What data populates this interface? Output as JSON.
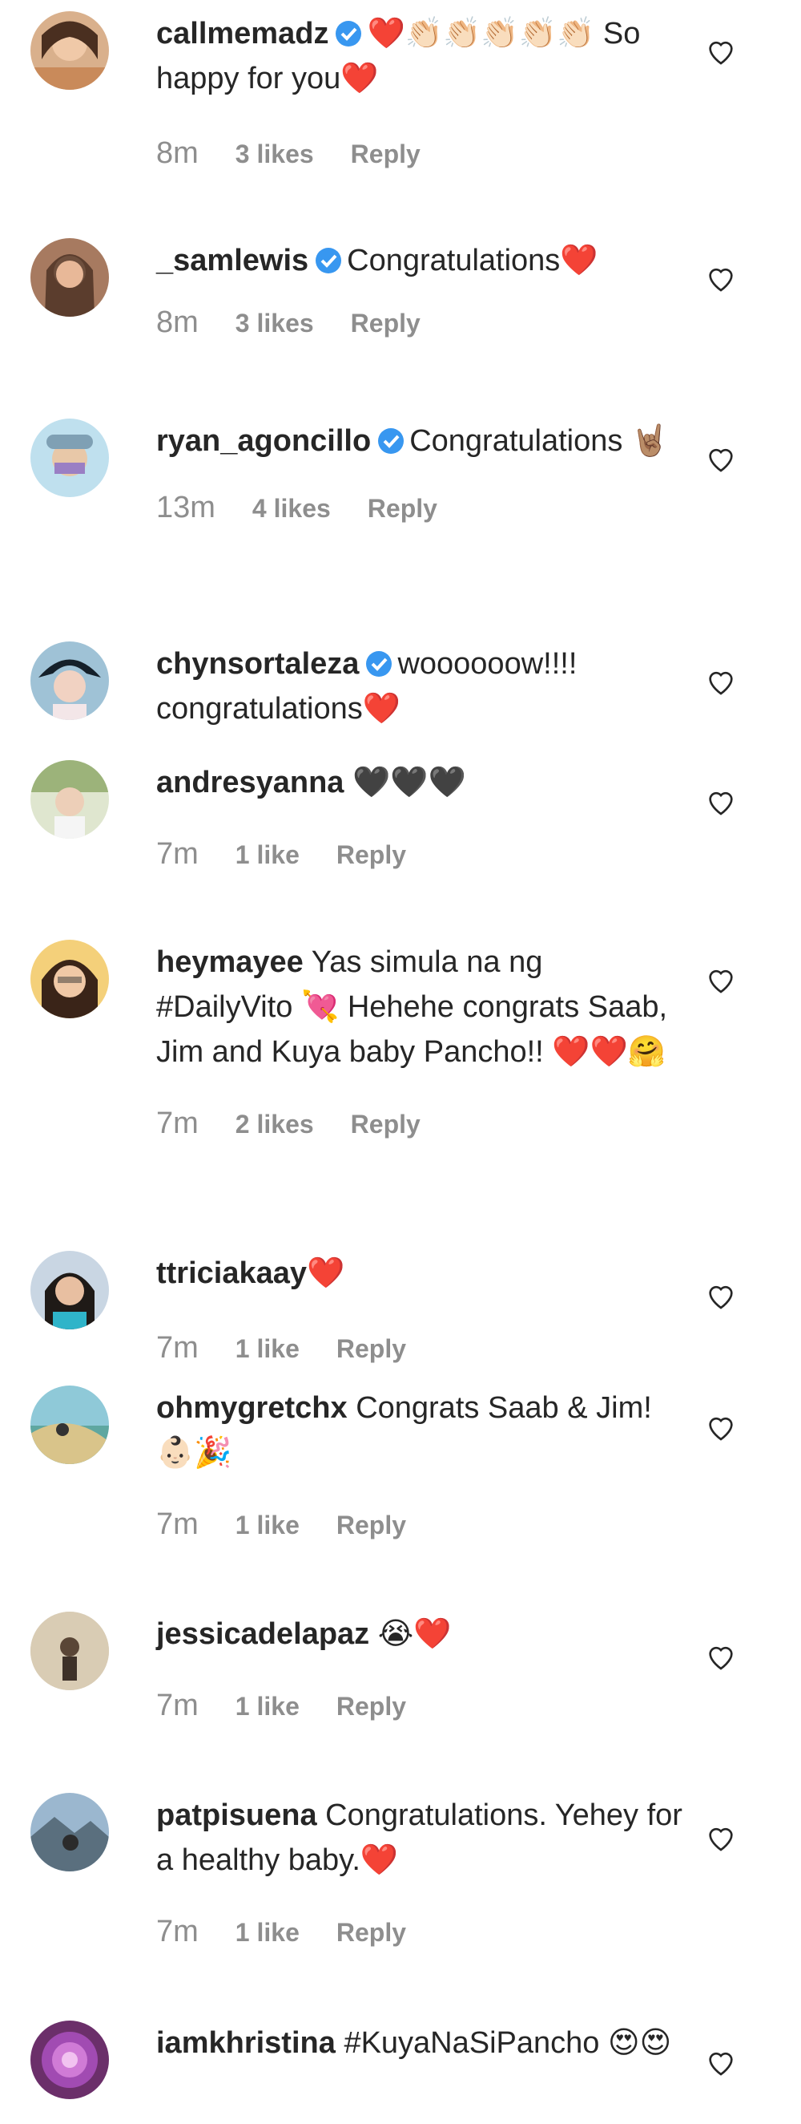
{
  "comments": [
    {
      "username": "callmemadz",
      "verified": true,
      "text": "❤️👏🏻👏🏻👏🏻👏🏻👏🏻 So happy for you❤️",
      "time": "8m",
      "likes": "3 likes",
      "reply": "Reply"
    },
    {
      "username": "_samlewis",
      "verified": true,
      "text": "Congratulations❤️",
      "time": "8m",
      "likes": "3 likes",
      "reply": "Reply"
    },
    {
      "username": "ryan_agoncillo",
      "verified": true,
      "text": "Congratulations 🤘🏽",
      "time": "13m",
      "likes": "4 likes",
      "reply": "Reply"
    },
    {
      "username": "chynsortaleza",
      "verified": true,
      "text": "woooooow!!!! congratulations❤️",
      "time": "",
      "likes": "",
      "reply": ""
    },
    {
      "username": "andresyanna",
      "verified": false,
      "text": "🖤🖤🖤",
      "time": "7m",
      "likes": "1 like",
      "reply": "Reply"
    },
    {
      "username": "heymayee",
      "verified": false,
      "text": "Yas simula na ng #DailyVito 💘 Hehehe congrats Saab, Jim and Kuya baby Pancho!! ❤️❤️🤗",
      "time": "7m",
      "likes": "2 likes",
      "reply": "Reply"
    },
    {
      "username": "ttriciakaay",
      "verified": false,
      "text": "❤️",
      "time": "7m",
      "likes": "1 like",
      "reply": "Reply"
    },
    {
      "username": "ohmygretchx",
      "verified": false,
      "text": "Congrats Saab & Jim! 👶🏻🎉",
      "time": "7m",
      "likes": "1 like",
      "reply": "Reply"
    },
    {
      "username": "jessicadelapaz",
      "verified": false,
      "text": "😭❤️",
      "time": "7m",
      "likes": "1 like",
      "reply": "Reply"
    },
    {
      "username": "patpisuena",
      "verified": false,
      "text": "Congratulations. Yehey for a healthy baby.❤️",
      "time": "7m",
      "likes": "1 like",
      "reply": "Reply"
    },
    {
      "username": "iamkhristina",
      "verified": false,
      "text": "#KuyaNaSiPancho 😍😍",
      "time": "",
      "likes": "",
      "reply": ""
    }
  ],
  "icons": {
    "verified": "verified-badge-icon",
    "like": "heart-outline-icon"
  },
  "colors": {
    "verified": "#3897f0",
    "meta": "#8e8e8e",
    "text": "#262626"
  }
}
